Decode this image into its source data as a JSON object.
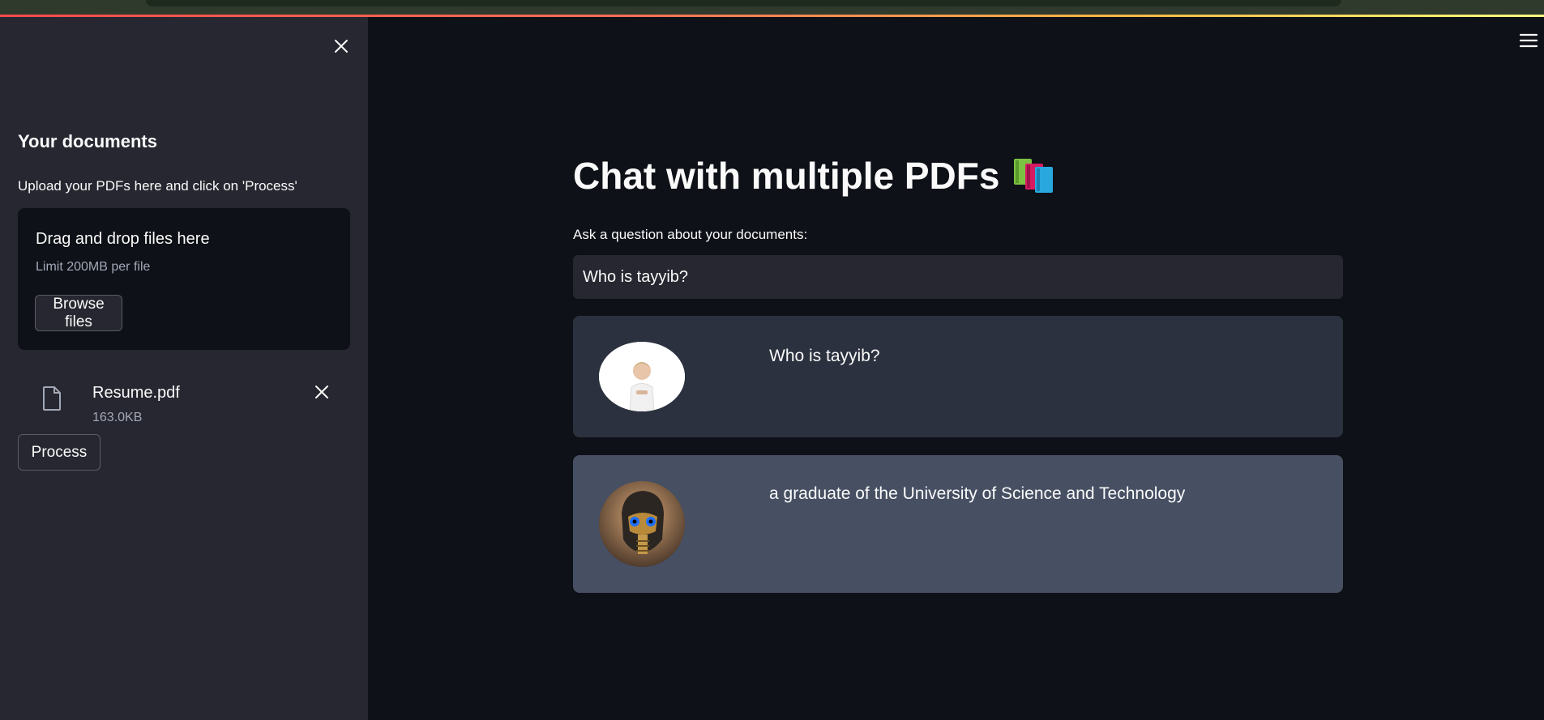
{
  "sidebar": {
    "title": "Your documents",
    "description": "Upload your PDFs here and click on 'Process'",
    "uploader": {
      "drop_text": "Drag and drop files here",
      "limit_text": "Limit 200MB per file",
      "browse_label": "Browse files"
    },
    "file": {
      "name": "Resume.pdf",
      "size": "163.0KB"
    },
    "process_label": "Process"
  },
  "main": {
    "title": "Chat with multiple PDFs",
    "title_icon": "books-icon",
    "question_label": "Ask a question about your documents:",
    "question_value": "Who is tayyib?",
    "messages": [
      {
        "role": "user",
        "avatar": "user-avatar",
        "text": "Who is tayyib?"
      },
      {
        "role": "bot",
        "avatar": "bot-avatar",
        "text": "a graduate of the University of Science and Technology"
      }
    ]
  },
  "colors": {
    "background": "#0e1117",
    "sidebar": "#262730",
    "user_message": "#2b313e",
    "bot_message": "#475063",
    "accent": "#ff4b4b"
  }
}
